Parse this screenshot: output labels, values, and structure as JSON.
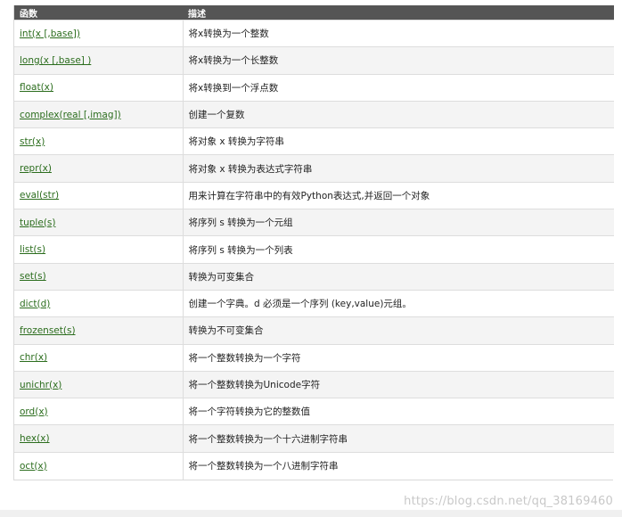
{
  "table": {
    "headers": [
      "函数",
      "描述"
    ],
    "rows": [
      {
        "func": "int(x [,base])",
        "desc": "将x转换为一个整数"
      },
      {
        "func": "long(x [,base] )",
        "desc": "将x转换为一个长整数"
      },
      {
        "func": "float(x)",
        "desc": "将x转换到一个浮点数"
      },
      {
        "func": "complex(real [,imag])",
        "desc": "创建一个复数"
      },
      {
        "func": "str(x)",
        "desc": "将对象 x 转换为字符串"
      },
      {
        "func": "repr(x)",
        "desc": "将对象 x 转换为表达式字符串"
      },
      {
        "func": "eval(str)",
        "desc": "用来计算在字符串中的有效Python表达式,并返回一个对象"
      },
      {
        "func": "tuple(s)",
        "desc": "将序列 s 转换为一个元组"
      },
      {
        "func": "list(s)",
        "desc": "将序列 s 转换为一个列表"
      },
      {
        "func": "set(s)",
        "desc": "转换为可变集合"
      },
      {
        "func": "dict(d)",
        "desc": "创建一个字典。d 必须是一个序列 (key,value)元组。"
      },
      {
        "func": "frozenset(s)",
        "desc": "转换为不可变集合"
      },
      {
        "func": "chr(x)",
        "desc": "将一个整数转换为一个字符"
      },
      {
        "func": "unichr(x)",
        "desc": "将一个整数转换为Unicode字符"
      },
      {
        "func": "ord(x)",
        "desc": "将一个字符转换为它的整数值"
      },
      {
        "func": "hex(x)",
        "desc": "将一个整数转换为一个十六进制字符串"
      },
      {
        "func": "oct(x)",
        "desc": "将一个整数转换为一个八进制字符串"
      }
    ]
  },
  "watermark": "https://blog.csdn.net/qq_38169460",
  "colors": {
    "header_bg": "#555555",
    "link": "#2b6d1d",
    "row_alt": "#f4f4f4"
  }
}
